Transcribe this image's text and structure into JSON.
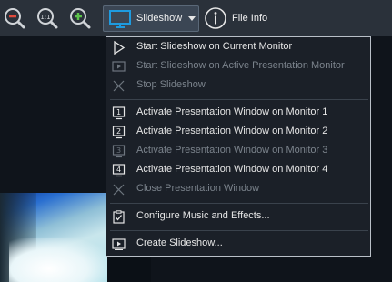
{
  "toolbar": {
    "slideshow_label": "Slideshow",
    "fileinfo_label": "File Info"
  },
  "menu": {
    "items": [
      {
        "label": "Start Slideshow on Current Monitor",
        "enabled": true,
        "icon": "play-icon"
      },
      {
        "label": "Start Slideshow on Active Presentation Monitor",
        "enabled": false,
        "icon": "play-monitor-icon"
      },
      {
        "label": "Stop Slideshow",
        "enabled": false,
        "icon": "close-icon"
      },
      {
        "label": "Activate Presentation Window on Monitor 1",
        "enabled": true,
        "icon": "monitor-1-icon"
      },
      {
        "label": "Activate Presentation Window on Monitor 2",
        "enabled": true,
        "icon": "monitor-2-icon"
      },
      {
        "label": "Activate Presentation Window on Monitor 3",
        "enabled": false,
        "icon": "monitor-3-icon"
      },
      {
        "label": "Activate Presentation Window on Monitor 4",
        "enabled": true,
        "icon": "monitor-4-icon"
      },
      {
        "label": "Close Presentation Window",
        "enabled": false,
        "icon": "close-icon"
      },
      {
        "label": "Configure Music and Effects...",
        "enabled": true,
        "icon": "checklist-icon"
      },
      {
        "label": "Create Slideshow...",
        "enabled": true,
        "icon": "slideshow-create-icon"
      }
    ]
  },
  "monitor_numbers": [
    "1",
    "2",
    "3",
    "4"
  ],
  "colors": {
    "toolbar_bg": "#2a313a",
    "menu_bg": "#1b2028",
    "accent_blue": "#1e9be0",
    "zoom_green": "#5cc24a",
    "zoom_red": "#e04a3c"
  }
}
